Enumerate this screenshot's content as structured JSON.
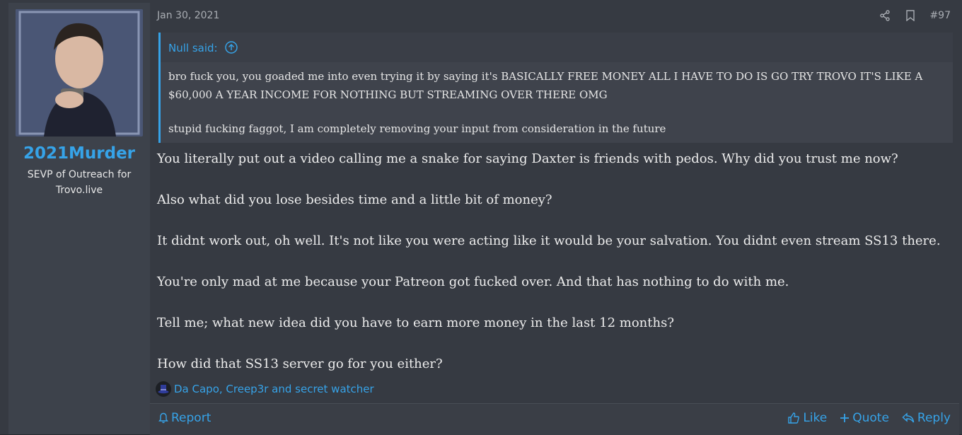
{
  "author": {
    "username": "2021Murder",
    "title": "SEVP of Outreach for Trovo.live"
  },
  "post": {
    "date": "Jan 30, 2021",
    "number": "#97",
    "quote": {
      "who": "Null said:",
      "paragraphs": [
        "bro fuck you, you goaded me into even trying it by saying it's BASICALLY FREE MONEY ALL I HAVE TO DO IS GO TRY TROVO IT'S LIKE A $60,000 A YEAR INCOME FOR NOTHING BUT STREAMING OVER THERE OMG",
        "stupid fucking faggot, I am completely removing your input from consideration in the future"
      ]
    },
    "body": [
      "You literally put out a video calling me a snake for saying Daxter is friends with pedos. Why did you trust me now?",
      "Also what did you lose besides time and a little bit of money?",
      "It didnt work out, oh well. It's not like you were acting like it would be your salvation. You didnt even stream SS13 there.",
      "You're only mad at me because your Patreon got fucked over. And that has nothing to do with me.",
      "Tell me; what new idea did you have to earn more money in the last 12 months?",
      "How did that SS13 server go for you either?"
    ],
    "reactions": "Da Capo, Creep3r and secret watcher"
  },
  "footer": {
    "report": "Report",
    "like": "Like",
    "quote": "Quote",
    "reply": "Reply"
  },
  "colors": {
    "accent": "#36a3e8",
    "background": "#363a42",
    "sidebar": "#3d424b"
  },
  "icons": [
    "share-icon",
    "bookmark-icon",
    "quote-up-icon",
    "top-hat-icon",
    "bell-icon",
    "thumbs-up-icon",
    "plus-icon",
    "reply-icon"
  ]
}
